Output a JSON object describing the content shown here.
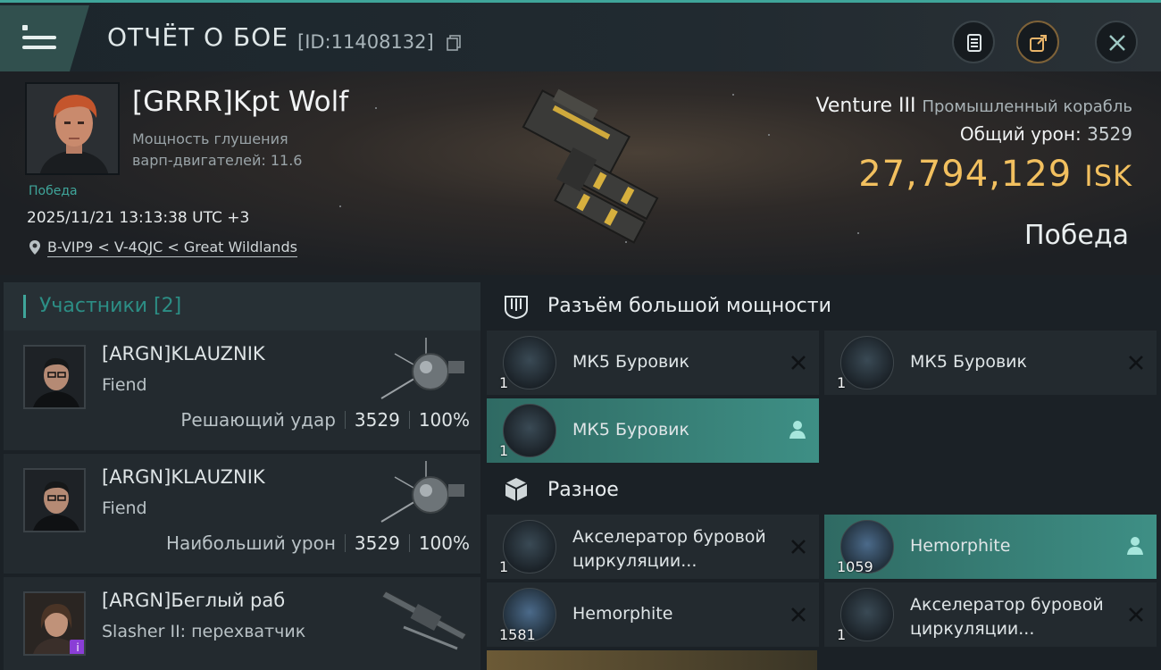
{
  "header": {
    "title": "ОТЧЁТ О БОЕ",
    "report_id": "[ID:11408132]",
    "icons": [
      "menu-icon",
      "copy-icon",
      "clipboard-icon",
      "share-icon",
      "close-icon"
    ]
  },
  "hero": {
    "pilot_name": "[GRRR]Kpt Wolf",
    "pilot_stat": "Мощность глушения варп-двигателей: 11.6",
    "victory_small": "Победа",
    "datetime": "2025/11/21 13:13:38 UTC +3",
    "location": "B-VIP9 < V-4QJC < Great Wildlands",
    "ship_name": "Venture III",
    "ship_class": "Промышленный корабль",
    "damage_label": "Общий урон:",
    "damage_value": "3529",
    "isk_value": "27,794,129",
    "isk_unit": "ISK",
    "result": "Победа"
  },
  "participants": {
    "header": "Участники [2]",
    "rows": [
      {
        "name": "[ARGN]KLAUZNIK",
        "ship": "Fiend",
        "stat_label": "Решающий удар",
        "damage": "3529",
        "percent": "100%"
      },
      {
        "name": "[ARGN]KLAUZNIK",
        "ship": "Fiend",
        "stat_label": "Наибольший урон",
        "damage": "3529",
        "percent": "100%"
      },
      {
        "name": "[ARGN]Беглый раб",
        "ship": "Slasher II: перехватчик",
        "badge": "i"
      }
    ]
  },
  "fitting": {
    "high_slots_title": "Разъём большой мощности",
    "high_slots": [
      {
        "name": "МК5 Буровик",
        "qty": "1",
        "state": "destroyed"
      },
      {
        "name": "МК5 Буровик",
        "qty": "1",
        "state": "destroyed"
      },
      {
        "name": "МК5 Буровик",
        "qty": "1",
        "state": "dropped"
      }
    ],
    "misc_title": "Разное",
    "misc": [
      {
        "name": "Акселератор буровой циркуляции...",
        "qty": "1",
        "state": "destroyed"
      },
      {
        "name": "Hemorphite",
        "qty": "1059",
        "state": "dropped"
      },
      {
        "name": "Hemorphite",
        "qty": "1581",
        "state": "destroyed"
      },
      {
        "name": "Акселератор буровой циркуляции...",
        "qty": "1",
        "state": "destroyed"
      }
    ]
  },
  "colors": {
    "accent": "#3fa59a",
    "isk": "#f2c05f",
    "active_slot": "#3e8f85"
  }
}
